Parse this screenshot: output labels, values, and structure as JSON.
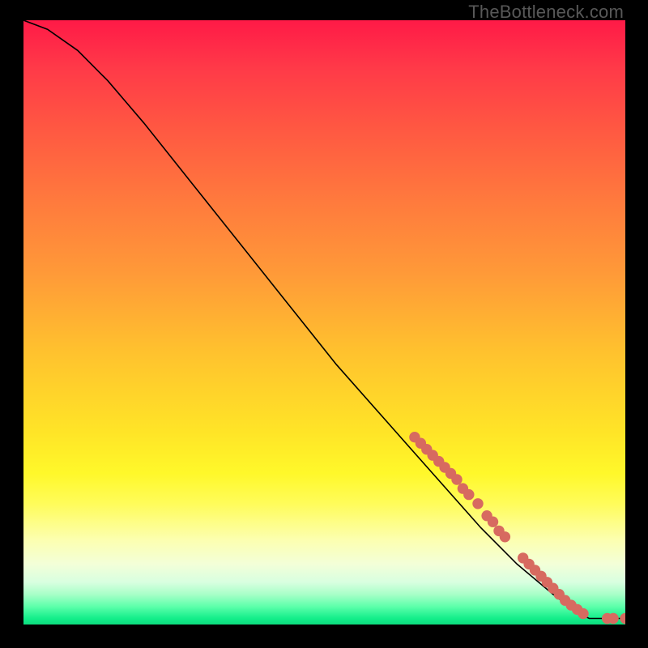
{
  "watermark": "TheBottleneck.com",
  "chart_data": {
    "type": "line",
    "title": "",
    "xlabel": "",
    "ylabel": "",
    "xlim": [
      0,
      100
    ],
    "ylim": [
      0,
      100
    ],
    "curve": {
      "name": "bottleneck-curve",
      "points": [
        {
          "x": 0,
          "y": 100
        },
        {
          "x": 4,
          "y": 98.5
        },
        {
          "x": 9,
          "y": 95
        },
        {
          "x": 14,
          "y": 90
        },
        {
          "x": 20,
          "y": 83
        },
        {
          "x": 28,
          "y": 73
        },
        {
          "x": 36,
          "y": 63
        },
        {
          "x": 44,
          "y": 53
        },
        {
          "x": 52,
          "y": 43
        },
        {
          "x": 60,
          "y": 34
        },
        {
          "x": 68,
          "y": 25
        },
        {
          "x": 76,
          "y": 16
        },
        {
          "x": 82,
          "y": 10
        },
        {
          "x": 88,
          "y": 5
        },
        {
          "x": 92,
          "y": 2
        },
        {
          "x": 94,
          "y": 1
        },
        {
          "x": 96,
          "y": 1
        },
        {
          "x": 98,
          "y": 1
        },
        {
          "x": 100,
          "y": 1
        }
      ]
    },
    "markers": {
      "name": "highlight-points",
      "color": "#d76a60",
      "radius_pct": 0.9,
      "points": [
        {
          "x": 65,
          "y": 31
        },
        {
          "x": 66,
          "y": 30
        },
        {
          "x": 67,
          "y": 29
        },
        {
          "x": 68,
          "y": 28
        },
        {
          "x": 69,
          "y": 27
        },
        {
          "x": 70,
          "y": 26
        },
        {
          "x": 71,
          "y": 25
        },
        {
          "x": 72,
          "y": 24
        },
        {
          "x": 73,
          "y": 22.5
        },
        {
          "x": 74,
          "y": 21.5
        },
        {
          "x": 75.5,
          "y": 20
        },
        {
          "x": 77,
          "y": 18
        },
        {
          "x": 78,
          "y": 17
        },
        {
          "x": 79,
          "y": 15.5
        },
        {
          "x": 80,
          "y": 14.5
        },
        {
          "x": 83,
          "y": 11
        },
        {
          "x": 84,
          "y": 10
        },
        {
          "x": 85,
          "y": 9
        },
        {
          "x": 86,
          "y": 8
        },
        {
          "x": 87,
          "y": 7
        },
        {
          "x": 88,
          "y": 6
        },
        {
          "x": 89,
          "y": 5
        },
        {
          "x": 90,
          "y": 4
        },
        {
          "x": 91,
          "y": 3.2
        },
        {
          "x": 92,
          "y": 2.5
        },
        {
          "x": 93,
          "y": 1.8
        },
        {
          "x": 97,
          "y": 1
        },
        {
          "x": 98,
          "y": 1
        },
        {
          "x": 100,
          "y": 1
        }
      ]
    }
  }
}
